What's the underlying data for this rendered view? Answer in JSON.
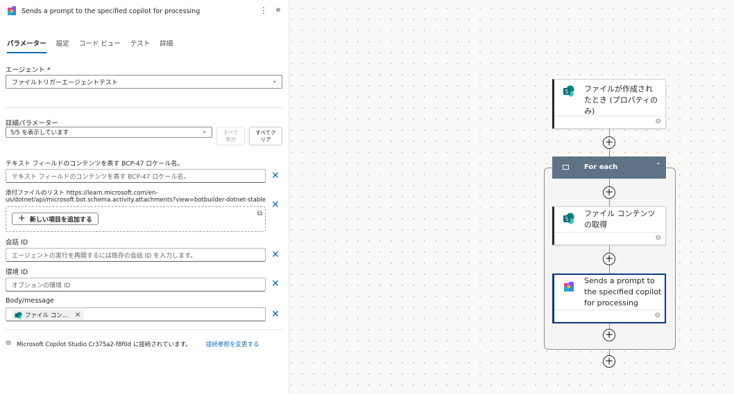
{
  "header": {
    "title": "Sends a prompt to the specified copilot for processing",
    "more_label": "⋮",
    "collapse_label": "«"
  },
  "tabs": [
    {
      "label": "パラメーター"
    },
    {
      "label": "設定"
    },
    {
      "label": "コード ビュー"
    },
    {
      "label": "テスト"
    },
    {
      "label": "詳細"
    }
  ],
  "agent": {
    "label": "エージェント *",
    "value": "ファイルトリガーエージェントテスト"
  },
  "advanced": {
    "label": "詳細パラメーター",
    "value": "5/5 を表示しています",
    "show_all": "すべて\n表示",
    "clear_all": "すべてク\nリア"
  },
  "locale": {
    "label": "テキスト フィールドのコンテンツを表す BCP-47 ロケール名。",
    "placeholder": "テキスト フィールドのコンテンツを表す BCP-47 ロケール名。"
  },
  "attachments": {
    "label_line1": "添付ファイルのリスト https://learn.microsoft.com/en-",
    "label_line2": "us/dotnet/api/microsoft.bot.schema.activity.attachments?view=botbuilder-dotnet-stable",
    "add_button": "新しい項目を追加する"
  },
  "conversation": {
    "label": "会話 ID",
    "placeholder": "エージェントの実行を再開するには既存の会話 ID を入力します。"
  },
  "environment": {
    "label": "環境 ID",
    "placeholder": "オプションの環境 ID"
  },
  "body": {
    "label": "Body/message",
    "token": "ファイル コン..."
  },
  "footer": {
    "text": "Microsoft Copilot Studio Cr375a2-f8f0d に接続されています。",
    "link": "接続参照を変更する"
  },
  "flow": {
    "trigger_title": "ファイルが作成され\nたとき (プロパティの\nみ)",
    "foreach_label": "For each",
    "get_content_title": "ファイル コンテンツ\nの取得",
    "copilot_title": "Sends a prompt to\nthe specified copilot\nfor processing"
  },
  "colors": {
    "accent": "#0f6cbd",
    "loop_header": "#5f7386",
    "selected_border": "#0f3c8a",
    "sharepoint": "#038387"
  }
}
